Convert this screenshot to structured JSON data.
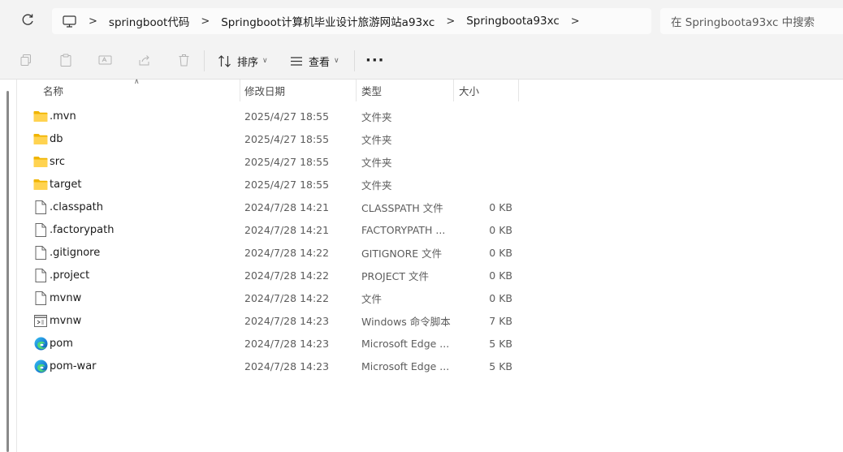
{
  "breadcrumbs": [
    "springboot代码",
    "Springboot计算机毕业设计旅游网站a93xc",
    "Springboota93xc"
  ],
  "search_placeholder": "在 Springboota93xc 中搜索",
  "toolbar": {
    "sort_label": "排序",
    "view_label": "查看"
  },
  "columns": {
    "name": "名称",
    "date": "修改日期",
    "type": "类型",
    "size": "大小"
  },
  "files": [
    {
      "name": ".mvn",
      "date": "2025/4/27 18:55",
      "type": "文件夹",
      "size": "",
      "icon": "folder-icon"
    },
    {
      "name": "db",
      "date": "2025/4/27 18:55",
      "type": "文件夹",
      "size": "",
      "icon": "folder-icon"
    },
    {
      "name": "src",
      "date": "2025/4/27 18:55",
      "type": "文件夹",
      "size": "",
      "icon": "folder-icon"
    },
    {
      "name": "target",
      "date": "2025/4/27 18:55",
      "type": "文件夹",
      "size": "",
      "icon": "folder-icon"
    },
    {
      "name": ".classpath",
      "date": "2024/7/28 14:21",
      "type": "CLASSPATH 文件",
      "size": "0 KB",
      "icon": "file-icon"
    },
    {
      "name": ".factorypath",
      "date": "2024/7/28 14:21",
      "type": "FACTORYPATH ...",
      "size": "0 KB",
      "icon": "file-icon"
    },
    {
      "name": ".gitignore",
      "date": "2024/7/28 14:22",
      "type": "GITIGNORE 文件",
      "size": "0 KB",
      "icon": "file-icon"
    },
    {
      "name": ".project",
      "date": "2024/7/28 14:22",
      "type": "PROJECT 文件",
      "size": "0 KB",
      "icon": "file-icon"
    },
    {
      "name": "mvnw",
      "date": "2024/7/28 14:22",
      "type": "文件",
      "size": "0 KB",
      "icon": "file-icon"
    },
    {
      "name": "mvnw",
      "date": "2024/7/28 14:23",
      "type": "Windows 命令脚本",
      "size": "7 KB",
      "icon": "script-icon"
    },
    {
      "name": "pom",
      "date": "2024/7/28 14:23",
      "type": "Microsoft Edge ...",
      "size": "5 KB",
      "icon": "edge-icon"
    },
    {
      "name": "pom-war",
      "date": "2024/7/28 14:23",
      "type": "Microsoft Edge ...",
      "size": "5 KB",
      "icon": "edge-icon"
    }
  ]
}
